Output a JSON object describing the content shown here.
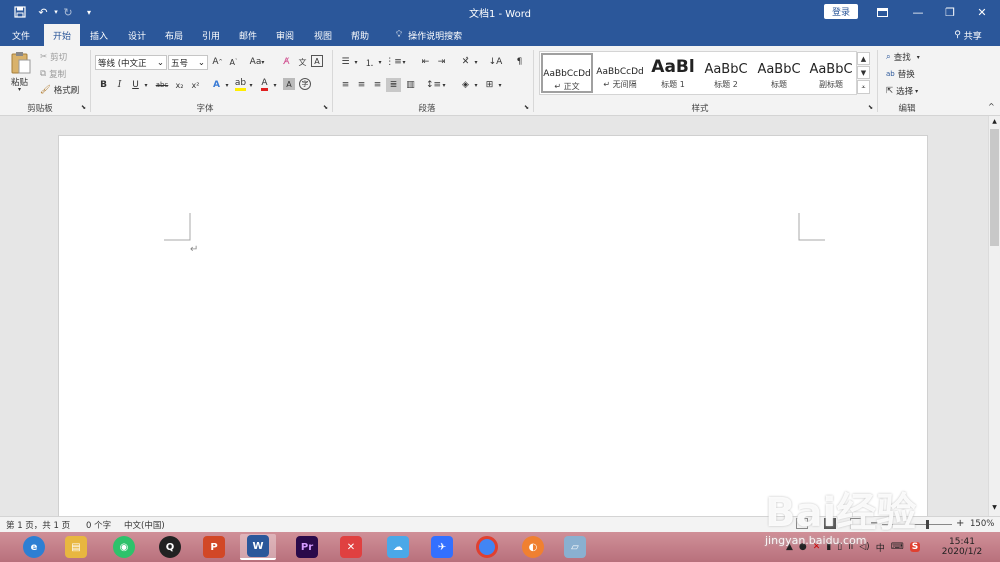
{
  "titlebar": {
    "title": "文档1 - Word",
    "login": "登录",
    "save_icon": "save-icon",
    "undo_icon": "undo-icon",
    "redo_icon": "redo-icon",
    "customize_icon": "customize-icon",
    "ribbon_opts_icon": "ribbon-display-icon",
    "min": "—",
    "max": "❐",
    "close": "✕",
    "bg": "#2b579a"
  },
  "tabs": [
    "文件",
    "开始",
    "插入",
    "设计",
    "布局",
    "引用",
    "邮件",
    "审阅",
    "视图",
    "帮助"
  ],
  "active_tab": "开始",
  "tellme": "操作说明搜索",
  "share": "共享",
  "clipboard": {
    "paste": "粘贴",
    "cut": "剪切",
    "copy": "复制",
    "format_painter": "格式刷",
    "label": "剪贴板"
  },
  "font": {
    "name": "等线 (中文正",
    "size": "五号",
    "label": "字体",
    "grow": "A",
    "shrink": "A",
    "case": "Aa",
    "bold": "B",
    "italic": "I",
    "underline": "U",
    "strike": "abc",
    "sub": "x₂",
    "sup": "x²"
  },
  "paragraph": {
    "label": "段落"
  },
  "styles": {
    "label": "样式",
    "items": [
      {
        "preview": "AaBbCcDd",
        "name": "正文"
      },
      {
        "preview": "AaBbCcDd",
        "name": "无间隔"
      },
      {
        "preview": "AaBl",
        "name": "标题 1"
      },
      {
        "preview": "AaBbC",
        "name": "标题 2"
      },
      {
        "preview": "AaBbC",
        "name": "标题"
      },
      {
        "preview": "AaBbC",
        "name": "副标题"
      }
    ]
  },
  "editing": {
    "find": "查找",
    "replace": "替换",
    "select": "选择",
    "label": "编辑"
  },
  "status": {
    "page": "第 1 页，共 1 页",
    "words": "0 个字",
    "lang": "中文(中国)",
    "zoom": "150%"
  },
  "taskbar": {
    "apps": [
      {
        "name": "browser-icon",
        "color": "#2d7fd3",
        "glyph": "e"
      },
      {
        "name": "file-explorer-icon",
        "color": "#e8b740",
        "glyph": "▤"
      },
      {
        "name": "wechat-icon",
        "color": "#2ec26b",
        "glyph": "◉"
      },
      {
        "name": "qq-icon",
        "color": "#222222",
        "glyph": "Q"
      },
      {
        "name": "powerpoint-icon",
        "color": "#d24726",
        "glyph": "P"
      },
      {
        "name": "word-icon",
        "color": "#2b579a",
        "glyph": "W"
      },
      {
        "name": "premiere-icon",
        "color": "#2a0a4a",
        "glyph": "Pr"
      },
      {
        "name": "xmind-icon",
        "color": "#e04040",
        "glyph": "✕"
      },
      {
        "name": "qq-browser-icon",
        "color": "#4aa8e8",
        "glyph": "☁"
      },
      {
        "name": "feishu-icon",
        "color": "#3370ff",
        "glyph": "✈"
      },
      {
        "name": "chrome-icon",
        "color": "#4285f4",
        "glyph": "●"
      },
      {
        "name": "firefox-like-icon",
        "color": "#f08030",
        "glyph": "◐"
      },
      {
        "name": "notes-icon",
        "color": "#8ab0d0",
        "glyph": "▱"
      }
    ],
    "time": "15:41",
    "date": "2020/1/2"
  },
  "watermark": "Bai经验",
  "watermark_url": "jingyan.baidu.com"
}
